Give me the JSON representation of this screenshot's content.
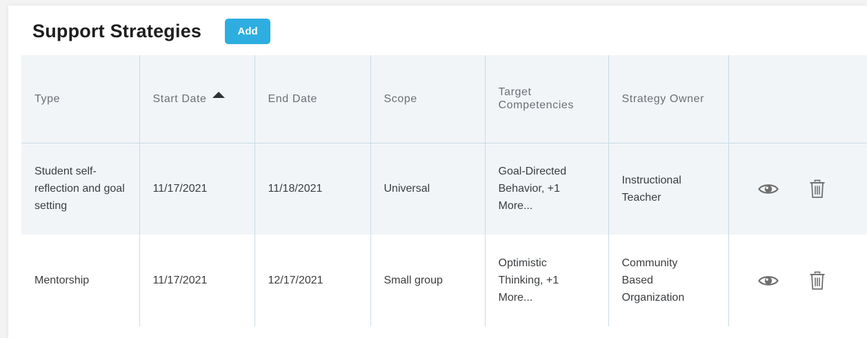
{
  "header": {
    "title": "Support Strategies",
    "add_label": "Add"
  },
  "table": {
    "columns": [
      "Type",
      "Start Date",
      "End Date",
      "Scope",
      "Target Competencies",
      "Strategy Owner",
      ""
    ],
    "rows": [
      {
        "type": "Student self-reflection and goal setting",
        "start_date": "11/17/2021",
        "end_date": "11/18/2021",
        "scope": "Universal",
        "target_competencies": "Goal-Directed Behavior, +1 More...",
        "owner": "Instructional Teacher"
      },
      {
        "type": "Mentorship",
        "start_date": "11/17/2021",
        "end_date": "12/17/2021",
        "scope": "Small group",
        "target_competencies": "Optimistic Thinking, +1 More...",
        "owner": "Community Based Organization"
      }
    ]
  },
  "icons": {
    "sort": "sort-ascending-icon",
    "view": "eye-icon",
    "delete": "trash-icon"
  },
  "colors": {
    "accent": "#2eaee0",
    "header_bg": "#f1f5f8",
    "grid": "#c9dbe3",
    "text": "#3a3d40"
  }
}
